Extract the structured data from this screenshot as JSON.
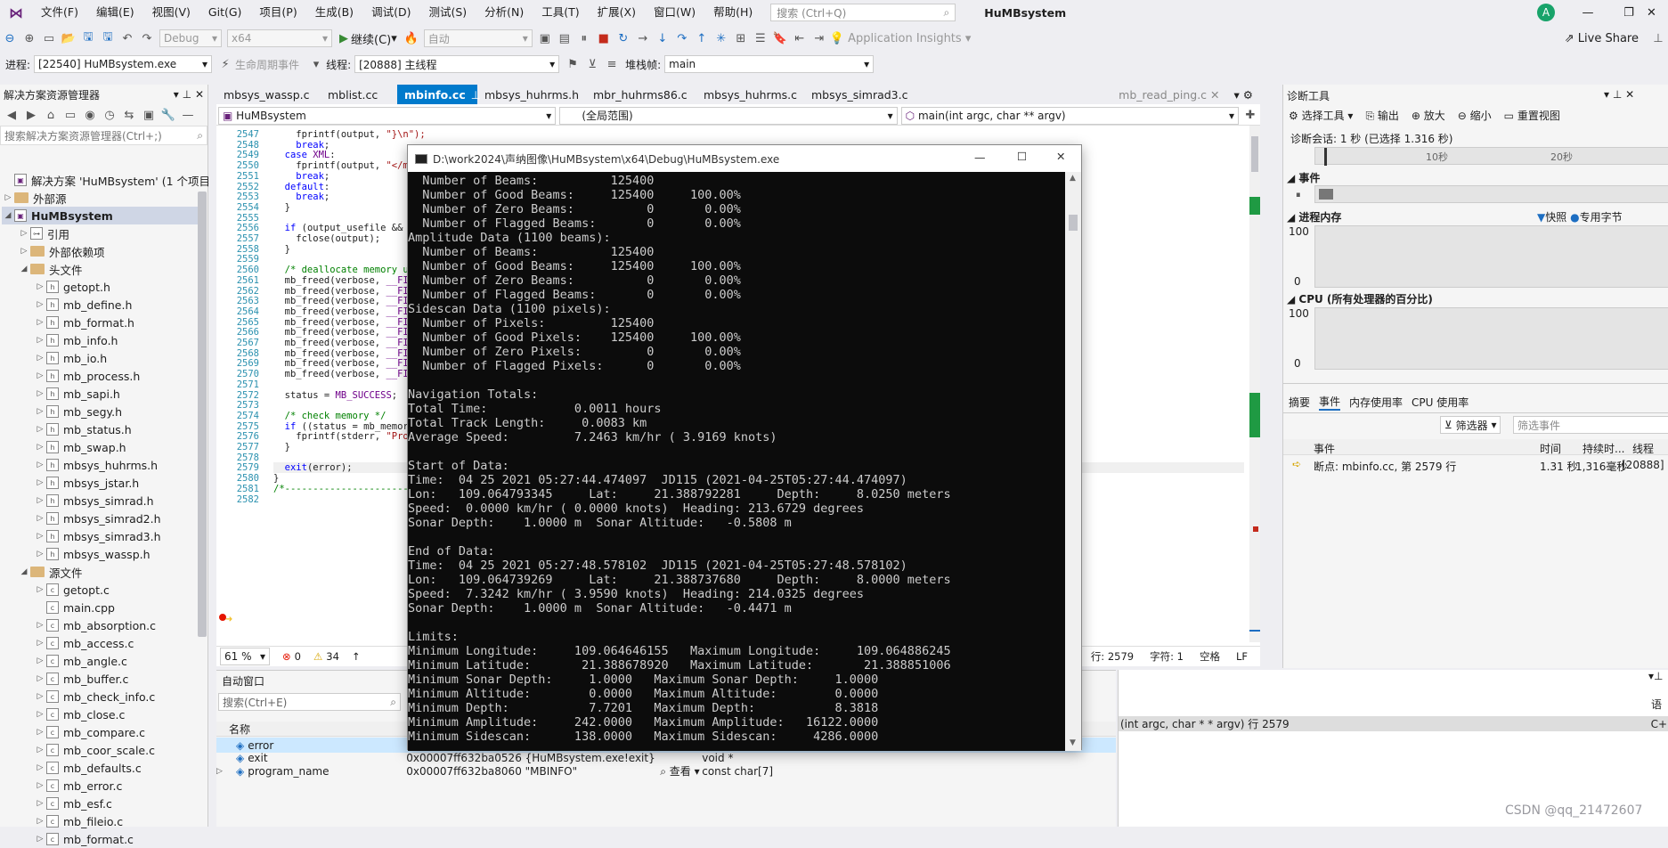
{
  "menubar": {
    "items": [
      "文件(F)",
      "编辑(E)",
      "视图(V)",
      "Git(G)",
      "项目(P)",
      "生成(B)",
      "调试(D)",
      "测试(S)",
      "分析(N)",
      "工具(T)",
      "扩展(X)",
      "窗口(W)",
      "帮助(H)"
    ],
    "search_placeholder": "搜索 (Ctrl+Q)",
    "app_name": "HuMBsystem",
    "avatar": "A"
  },
  "toolbar": {
    "config": "Debug",
    "platform": "x64",
    "continue_label": "继续(C)",
    "auto_label": "自动",
    "app_insights": "Application Insights",
    "live_share": "Live Share"
  },
  "debugbar": {
    "process_label": "进程:",
    "process_value": "[22540] HuMBsystem.exe",
    "lifecycle_label": "生命周期事件",
    "thread_label": "线程:",
    "thread_value": "[20888] 主线程",
    "stackframe_label": "堆栈帧:",
    "stackframe_value": "main"
  },
  "solution_explorer": {
    "title": "解决方案资源管理器",
    "search_placeholder": "搜索解决方案资源管理器(Ctrl+;)",
    "nodes": [
      {
        "label": "解决方案 'HuMBsystem' (1 个项目",
        "level": 0,
        "kind": "solution"
      },
      {
        "label": "外部源",
        "level": 0,
        "kind": "folder"
      },
      {
        "label": "HuMBsystem",
        "level": 0,
        "kind": "project"
      },
      {
        "label": "引用",
        "level": 1,
        "kind": "ref"
      },
      {
        "label": "外部依赖项",
        "level": 1,
        "kind": "folder"
      },
      {
        "label": "头文件",
        "level": 1,
        "kind": "folder"
      },
      {
        "label": "getopt.h",
        "level": 2,
        "kind": "file"
      },
      {
        "label": "mb_define.h",
        "level": 2,
        "kind": "file"
      },
      {
        "label": "mb_format.h",
        "level": 2,
        "kind": "file"
      },
      {
        "label": "mb_info.h",
        "level": 2,
        "kind": "file"
      },
      {
        "label": "mb_io.h",
        "level": 2,
        "kind": "file"
      },
      {
        "label": "mb_process.h",
        "level": 2,
        "kind": "file"
      },
      {
        "label": "mb_sapi.h",
        "level": 2,
        "kind": "file"
      },
      {
        "label": "mb_segy.h",
        "level": 2,
        "kind": "file"
      },
      {
        "label": "mb_status.h",
        "level": 2,
        "kind": "file"
      },
      {
        "label": "mb_swap.h",
        "level": 2,
        "kind": "file"
      },
      {
        "label": "mbsys_huhrms.h",
        "level": 2,
        "kind": "file"
      },
      {
        "label": "mbsys_jstar.h",
        "level": 2,
        "kind": "file"
      },
      {
        "label": "mbsys_simrad.h",
        "level": 2,
        "kind": "file"
      },
      {
        "label": "mbsys_simrad2.h",
        "level": 2,
        "kind": "file"
      },
      {
        "label": "mbsys_simrad3.h",
        "level": 2,
        "kind": "file"
      },
      {
        "label": "mbsys_wassp.h",
        "level": 2,
        "kind": "file"
      },
      {
        "label": "源文件",
        "level": 1,
        "kind": "folder"
      },
      {
        "label": "getopt.c",
        "level": 2,
        "kind": "file"
      },
      {
        "label": "main.cpp",
        "level": 2,
        "kind": "file"
      },
      {
        "label": "mb_absorption.c",
        "level": 2,
        "kind": "file"
      },
      {
        "label": "mb_access.c",
        "level": 2,
        "kind": "file"
      },
      {
        "label": "mb_angle.c",
        "level": 2,
        "kind": "file"
      },
      {
        "label": "mb_buffer.c",
        "level": 2,
        "kind": "file"
      },
      {
        "label": "mb_check_info.c",
        "level": 2,
        "kind": "file"
      },
      {
        "label": "mb_close.c",
        "level": 2,
        "kind": "file"
      },
      {
        "label": "mb_compare.c",
        "level": 2,
        "kind": "file"
      },
      {
        "label": "mb_coor_scale.c",
        "level": 2,
        "kind": "file"
      },
      {
        "label": "mb_defaults.c",
        "level": 2,
        "kind": "file"
      },
      {
        "label": "mb_error.c",
        "level": 2,
        "kind": "file"
      },
      {
        "label": "mb_esf.c",
        "level": 2,
        "kind": "file"
      },
      {
        "label": "mb_fileio.c",
        "level": 2,
        "kind": "file"
      },
      {
        "label": "mb_format.c",
        "level": 2,
        "kind": "file"
      }
    ]
  },
  "editor": {
    "tabs": [
      "mbsys_wassp.c",
      "mblist.cc",
      "mbinfo.cc",
      "mbsys_huhrms.h",
      "mbr_huhrms86.c",
      "mbsys_huhrms.c",
      "mbsys_simrad3.c",
      "mb_read_ping.c"
    ],
    "active_tab": 2,
    "nav_project": "HuMBsystem",
    "nav_scope": "(全局范围)",
    "nav_function": "main(int argc, char ** argv)",
    "line_numbers": [
      "2547",
      "2548",
      "2549",
      "2550",
      "2551",
      "2552",
      "2553",
      "2554",
      "2555",
      "2556",
      "2557",
      "2558",
      "2559",
      "2560",
      "2561",
      "2562",
      "2563",
      "2564",
      "2565",
      "2566",
      "2567",
      "2568",
      "2569",
      "2570",
      "2571",
      "2572",
      "2573",
      "2574",
      "2575",
      "2576",
      "2577",
      "2578",
      "2579",
      "2580",
      "2581",
      "2582"
    ],
    "code_lines": [
      "    fprintf(output, \"}\\n\");",
      "    break;",
      "  case XML:",
      "    fprintf(output, \"</mb",
      "    break;",
      "  default:",
      "    break;",
      "  }",
      "",
      "  if (output_usefile && ou",
      "    fclose(output);",
      "  }",
      "",
      "  /* deallocate memory use",
      "  mb_freed(verbose, __FILE",
      "  mb_freed(verbose, __FILE",
      "  mb_freed(verbose, __FILE",
      "  mb_freed(verbose, __FILE",
      "  mb_freed(verbose, __FILE",
      "  mb_freed(verbose, __FILE",
      "  mb_freed(verbose, __FILE",
      "  mb_freed(verbose, __FILE",
      "  mb_freed(verbose, __FILE",
      "  mb_freed(verbose, __FILE",
      "",
      "  status = MB_SUCCESS;",
      "",
      "  /* check memory */",
      "  if ((status = mb_memory",
      "    fprintf(stderr, \"Progr",
      "  }",
      "",
      "  exit(error);",
      "}",
      "/*---------------------------",
      ""
    ],
    "zoom": "61 %",
    "errors": "0",
    "warnings": "34",
    "line_info": "行: 2579",
    "char_info": "字符: 1",
    "space_info": "空格",
    "eol_info": "LF"
  },
  "console": {
    "title": "D:\\work2024\\声纳图像\\HuMBsystem\\x64\\Debug\\HuMBsystem.exe",
    "lines": [
      "  Number of Beams:          125400",
      "  Number of Good Beams:     125400     100.00%",
      "  Number of Zero Beams:          0       0.00%",
      "  Number of Flagged Beams:       0       0.00%",
      "Amplitude Data (1100 beams):",
      "  Number of Beams:          125400",
      "  Number of Good Beams:     125400     100.00%",
      "  Number of Zero Beams:          0       0.00%",
      "  Number of Flagged Beams:       0       0.00%",
      "Sidescan Data (1100 pixels):",
      "  Number of Pixels:         125400",
      "  Number of Good Pixels:    125400     100.00%",
      "  Number of Zero Pixels:         0       0.00%",
      "  Number of Flagged Pixels:      0       0.00%",
      "",
      "Navigation Totals:",
      "Total Time:            0.0011 hours",
      "Total Track Length:     0.0083 km",
      "Average Speed:         7.2463 km/hr ( 3.9169 knots)",
      "",
      "Start of Data:",
      "Time:  04 25 2021 05:27:44.474097  JD115 (2021-04-25T05:27:44.474097)",
      "Lon:   109.064793345     Lat:     21.388792281     Depth:     8.0250 meters",
      "Speed:  0.0000 km/hr ( 0.0000 knots)  Heading: 213.6729 degrees",
      "Sonar Depth:    1.0000 m  Sonar Altitude:   -0.5808 m",
      "",
      "End of Data:",
      "Time:  04 25 2021 05:27:48.578102  JD115 (2021-04-25T05:27:48.578102)",
      "Lon:   109.064739269     Lat:     21.388737680     Depth:     8.0000 meters",
      "Speed:  7.3242 km/hr ( 3.9590 knots)  Heading: 214.0325 degrees",
      "Sonar Depth:    1.0000 m  Sonar Altitude:   -0.4471 m",
      "",
      "Limits:",
      "Minimum Longitude:     109.064646155   Maximum Longitude:     109.064886245",
      "Minimum Latitude:       21.388678920   Maximum Latitude:       21.388851006",
      "Minimum Sonar Depth:     1.0000   Maximum Sonar Depth:     1.0000",
      "Minimum Altitude:        0.0000   Maximum Altitude:        0.0000",
      "Minimum Depth:           7.7201   Maximum Depth:           8.3818",
      "Minimum Amplitude:     242.0000   Maximum Amplitude:   16122.0000",
      "Minimum Sidescan:      138.0000   Maximum Sidescan:     4286.0000"
    ]
  },
  "autos": {
    "title": "自动窗口",
    "search_placeholder": "搜索(Ctrl+E)",
    "col_name": "名称",
    "rows": [
      {
        "name": "error",
        "value": "",
        "type": ""
      },
      {
        "name": "exit",
        "value": "0x00007ff632ba0526 {HuMBsystem.exe!exit}",
        "type": "void *"
      },
      {
        "name": "program_name",
        "value": "0x00007ff632ba8060 \"MBINFO\"",
        "type": "const char[7]"
      }
    ],
    "view_label": "查看"
  },
  "callstack": {
    "frame_text": "(int argc, char * * argv) 行 2579",
    "lang_hdr": "语",
    "lang": "C+"
  },
  "diagnostics": {
    "title": "诊断工具",
    "select_tool": "选择工具",
    "output": "输出",
    "zoom_in": "放大",
    "zoom_out": "缩小",
    "reset_view": "重置视图",
    "session": "诊断会话: 1 秒 (已选择 1.316 秒)",
    "tick_10": "10秒",
    "tick_20": "20秒",
    "events_label": "事件",
    "memory_label": "进程内存",
    "snapshot": "快照",
    "private_bytes": "专用字节",
    "mem_max": "100",
    "mem_min": "0",
    "cpu_label": "CPU (所有处理器的百分比)",
    "cpu_max": "100",
    "cpu_min": "0",
    "tabs": [
      "摘要",
      "事件",
      "内存使用率",
      "CPU 使用率"
    ],
    "filter_label": "筛选器",
    "filter_placeholder": "筛选事件",
    "col_event": "事件",
    "col_time": "时间",
    "col_duration": "持续时...",
    "col_thread": "线程",
    "event_text": "断点: mbinfo.cc, 第 2579 行",
    "event_time": "1.31 秒",
    "event_duration": "1,316毫秒",
    "event_thread": "[20888]"
  },
  "watermark": "CSDN @qq_21472607",
  "colors": {
    "accent": "#007acc",
    "console_bg": "#0c0c0c",
    "console_text": "#cccccc"
  }
}
